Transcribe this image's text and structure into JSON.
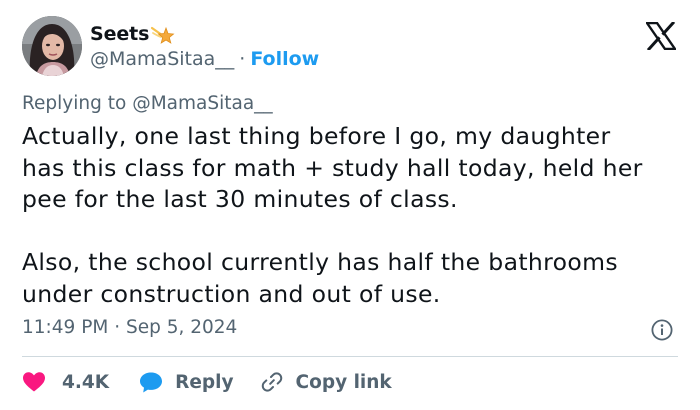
{
  "author": {
    "display_name": "Seets",
    "emoji": "shooting-star-emoji",
    "handle": "@MamaSitaa__",
    "separator": "·",
    "follow_label": "Follow"
  },
  "reply_context": {
    "prefix": "Replying to",
    "handle": "@MamaSitaa__"
  },
  "tweet": {
    "text": "Actually, one last thing before I go, my daughter\nhas this class for math + study hall today, held her\npee for the last 30 minutes of class.\n\nAlso, the school currently has half the bathrooms\nunder construction and out of use.",
    "timestamp": "11:49 PM · Sep 5, 2024"
  },
  "actions": {
    "likes_count": "4.4K",
    "reply_label": "Reply",
    "copy_link_label": "Copy link"
  },
  "icons": {
    "brand": "x-logo",
    "info": "info-icon",
    "like": "heart-icon",
    "reply": "speech-bubble-icon",
    "copy": "link-icon"
  },
  "colors": {
    "accent_blue": "#1d9bf0",
    "heart_pink": "#f91880",
    "text_primary": "#0f1419",
    "text_secondary": "#536471",
    "divider": "#cfd9de"
  }
}
